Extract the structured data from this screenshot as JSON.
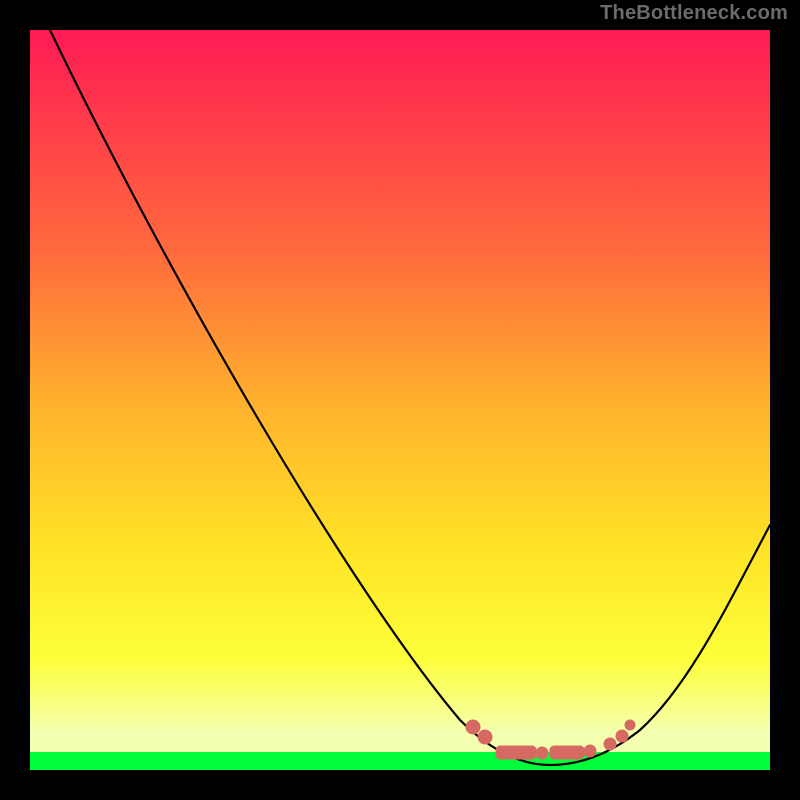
{
  "attribution": "TheBottleneck.com",
  "chart_data": {
    "type": "line",
    "title": "",
    "xlabel": "",
    "ylabel": "",
    "x_range": [
      0,
      1
    ],
    "y_range": [
      0,
      1
    ],
    "axes_visible": false,
    "grid": false,
    "note": "Values read from pixel positions; x and y normalized 0–1. y=0 is the green band (optimal / no bottleneck), y=1 is top (worst bottleneck).",
    "series": [
      {
        "name": "bottleneck-curve",
        "x": [
          0.03,
          0.1,
          0.2,
          0.3,
          0.4,
          0.5,
          0.58,
          0.64,
          0.7,
          0.76,
          0.82,
          0.88,
          0.94,
          1.0
        ],
        "y": [
          1.0,
          0.86,
          0.7,
          0.54,
          0.38,
          0.22,
          0.1,
          0.04,
          0.01,
          0.01,
          0.04,
          0.1,
          0.22,
          0.33
        ]
      }
    ],
    "markers": {
      "name": "optimal-region",
      "color": "#d66a63",
      "points": [
        {
          "x": 0.6,
          "y": 0.06
        },
        {
          "x": 0.62,
          "y": 0.04
        },
        {
          "x": 0.66,
          "y": 0.02
        },
        {
          "x": 0.69,
          "y": 0.02
        },
        {
          "x": 0.72,
          "y": 0.02
        },
        {
          "x": 0.76,
          "y": 0.02
        },
        {
          "x": 0.78,
          "y": 0.03
        },
        {
          "x": 0.8,
          "y": 0.05
        },
        {
          "x": 0.81,
          "y": 0.06
        }
      ]
    },
    "background": {
      "type": "vertical-gradient",
      "stops": [
        {
          "pos": 0.0,
          "color": "#ff1a55"
        },
        {
          "pos": 0.5,
          "color": "#ffb02e"
        },
        {
          "pos": 0.85,
          "color": "#fdff3a"
        },
        {
          "pos": 1.0,
          "color": "#00ff3a"
        }
      ],
      "meaning": "red = high bottleneck, green = none"
    }
  }
}
